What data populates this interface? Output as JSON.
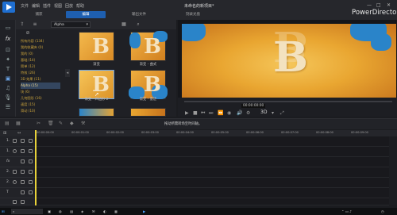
{
  "app": {
    "brand": "PowerDirector",
    "window_title": "未命名的新项目*",
    "menu": [
      "文件",
      "编辑",
      "插件",
      "视图",
      "回放",
      "帮助"
    ]
  },
  "rooms": {
    "capture": "捕获",
    "edit": "编辑",
    "produce": "输出文件",
    "disc": "刻录光盘"
  },
  "library": {
    "dropdown_value": "Alpha",
    "categories": [
      "所有内容 (134)",
      "我的收藏夹 (0)",
      "我的 (0)",
      "基础 (14)",
      "简单 (12)",
      "特效 (26)",
      "3D 效果 (11)",
      "Alpha (15)",
      "块 (6)",
      "几何图形 (16)",
      "速度 (15)",
      "滑动 (10)",
      "擦除 (15)",
      "其他 (14)"
    ],
    "selected_category": "Alpha (15)",
    "thumbs": [
      {
        "label": "渐变",
        "glyph": "B"
      },
      {
        "label": "渐变 - 曲式",
        "glyph": "B"
      },
      {
        "label": "渐变 - 四边形 2",
        "glyph": "B"
      },
      {
        "label": "渐变 - 墨迹",
        "glyph": "B"
      },
      {
        "label": "",
        "glyph": ""
      },
      {
        "label": "",
        "glyph": ""
      }
    ]
  },
  "preview": {
    "glyph": "B",
    "timecode": "00:00:00:00",
    "quality": "3D"
  },
  "timeline": {
    "tip": "拖动所需转场至时间轴。",
    "ruler": [
      "00:00:00:00",
      "00:00:01:00",
      "00:00:02:00",
      "00:00:03:00",
      "00:00:04:00",
      "00:00:05:00",
      "00:00:06:00",
      "00:00:07:00",
      "00:00:08:00",
      "00:00:09:00"
    ],
    "tracks": [
      {
        "num": "1."
      },
      {
        "num": "1."
      },
      {
        "num": ""
      },
      {
        "num": "2."
      },
      {
        "num": "2."
      },
      {
        "num": ""
      },
      {
        "num": "T"
      }
    ]
  },
  "colors": {
    "accent": "#1e5fb0",
    "playhead": "#e8d23a",
    "category_text": "#c9a23c"
  }
}
